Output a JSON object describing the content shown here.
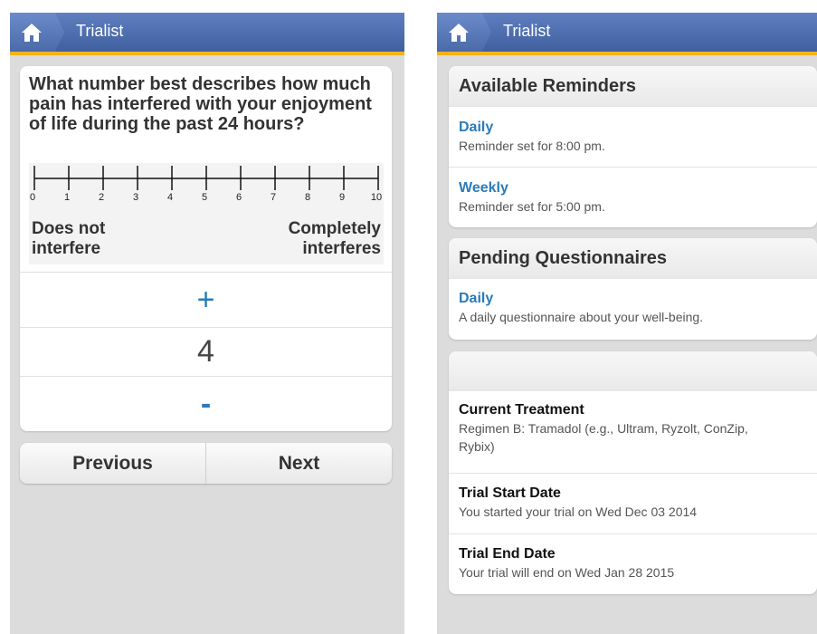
{
  "app": {
    "title": "Trialist",
    "home_icon": "house-icon"
  },
  "question": {
    "text": "What number best describes how much pain has interfered with your enjoyment of life during the past 24 hours?",
    "scale_numbers": [
      "0",
      "1",
      "2",
      "3",
      "4",
      "5",
      "6",
      "7",
      "8",
      "9",
      "10"
    ],
    "low_label": "Does not interfere",
    "high_label": "Completely interferes",
    "increment_label": "+",
    "value": "4",
    "decrement_label": "-"
  },
  "nav": {
    "previous_label": "Previous",
    "next_label": "Next"
  },
  "reminders": {
    "header": "Available Reminders",
    "items": [
      {
        "title": "Daily",
        "subtitle": "Reminder set for 8:00 pm."
      },
      {
        "title": "Weekly",
        "subtitle": "Reminder set for 5:00 pm."
      }
    ]
  },
  "questionnaires": {
    "header": "Pending Questionnaires",
    "items": [
      {
        "title": "Daily",
        "subtitle": "A daily questionnaire about your well-being."
      }
    ]
  },
  "trial": {
    "items": [
      {
        "title": "Current Treatment",
        "subtitle": "Regimen B: Tramadol (e.g., Ultram, Ryzolt, ConZip, Rybix)"
      },
      {
        "title": "Trial Start Date",
        "subtitle": "You started your trial on Wed Dec 03 2014"
      },
      {
        "title": "Trial End Date",
        "subtitle": "Your trial will end on Wed Jan 28 2015"
      }
    ]
  },
  "colors": {
    "accent_blue": "#2b7bb9",
    "header_blue": "#4a6aa8",
    "header_underline": "#f5b21c"
  }
}
